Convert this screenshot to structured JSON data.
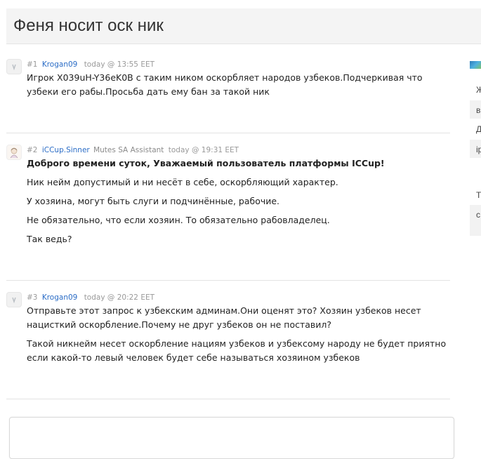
{
  "thread": {
    "title": "Феня носит оск ник"
  },
  "posts": [
    {
      "number": "#1",
      "author": "Krogan09",
      "role": "",
      "time": "today @ 13:55 EET",
      "paragraphs": [
        "Игрок X039uH-Y36eK0B с таким ником оскорбляет народов узбеков.Подчеркивая что узбеки его рабы.Просьба дать ему бан за такой ник"
      ]
    },
    {
      "number": "#2",
      "author": "iCCup.Sinner",
      "role": "Mutes SA Assistant",
      "time": "today @ 19:31 EET",
      "paragraphs": [
        "Доброго времени суток, Уважаемый пользователь платформы ICCup!",
        "Ник нейм допустимый и ни несёт в себе, оскорбляющий характер.",
        "У хозяина, могут быть слуги и подчинённые, рабочие.",
        "Не обязательно, что если хозяин. То обязательно рабовладелец.",
        "Так ведь?"
      ]
    },
    {
      "number": "#3",
      "author": "Krogan09",
      "role": "",
      "time": "today @ 20:22 EET",
      "paragraphs": [
        "Отправьте этот запрос к узбекским админам.Они оценят это? Хозяин узбеков несет нацисткий оскорбление.Почему не друг узбеков он не поставил?",
        "Такой никнейм несет оскорбление нациям узбеков и узбексому народу не будет приятно если какой-то левый человек будет себе называться хозяином узбеков"
      ]
    }
  ],
  "sidebar": {
    "fragments": [
      "Ж",
      "в",
      "Д",
      "ip",
      "Т",
      "с"
    ]
  },
  "icons": {
    "avatar_default": "user-icon",
    "avatar_anime": "anime-avatar-icon",
    "flag": "flag-icon"
  }
}
